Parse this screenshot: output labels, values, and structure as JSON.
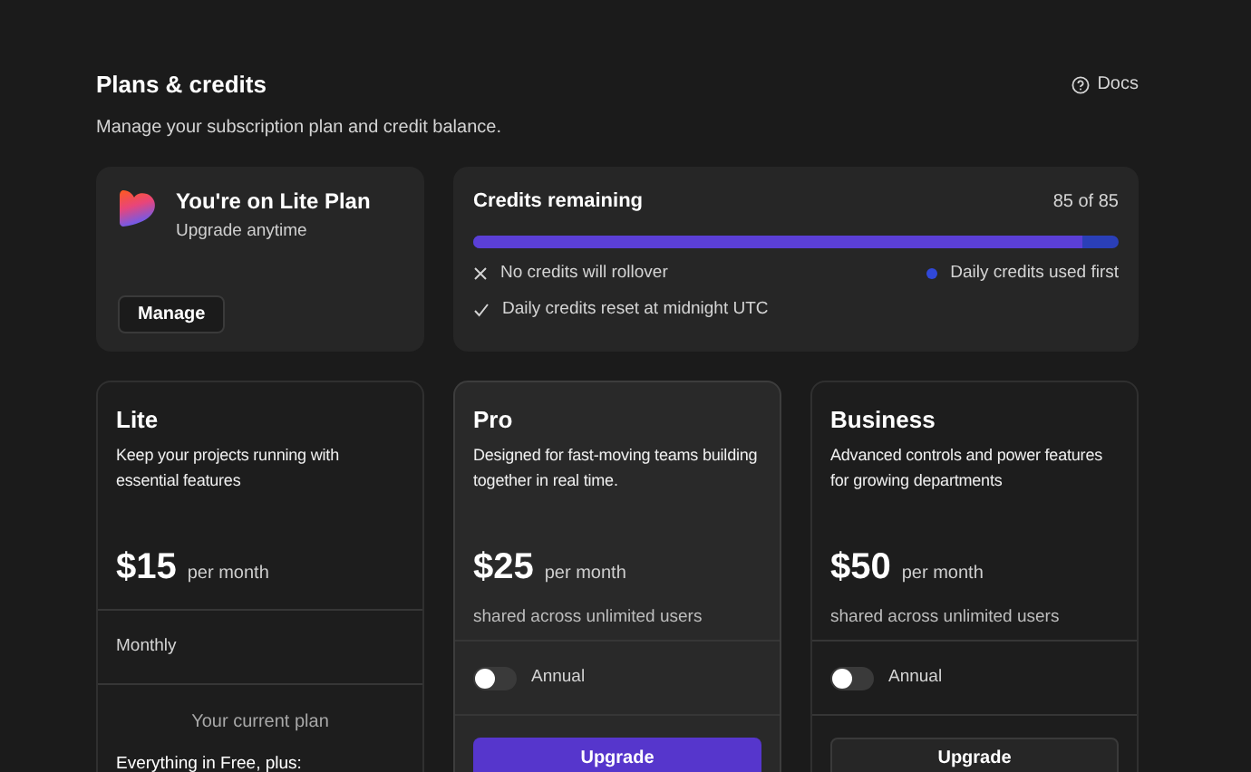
{
  "header": {
    "title": "Plans & credits",
    "subtitle": "Manage your subscription plan and credit balance.",
    "docs_link": "Docs"
  },
  "current_plan": {
    "title": "You're on Lite Plan",
    "subtitle": "Upgrade anytime",
    "button": "Manage"
  },
  "credits": {
    "title": "Credits remaining",
    "count": "85 of 85",
    "level": 0.945,
    "notes": [
      {
        "kind": "cross",
        "text": "No credits will rollover"
      },
      {
        "kind": "check",
        "text": "Daily credits reset at midnight UTC"
      }
    ],
    "legend": {
      "text": "Daily credits used first",
      "color": "#3048d8"
    }
  },
  "plans": [
    {
      "name": "Lite",
      "description": "Keep your projects running with essential features",
      "price": "$15",
      "period": "per month",
      "featured": false,
      "billing": {
        "kind": "label",
        "text": "Monthly"
      },
      "action": {
        "kind": "current",
        "text": "Your current plan"
      },
      "features_heading": "Everything in Free, plus:"
    },
    {
      "name": "Pro",
      "description": "Designed for fast-moving teams building together in real time.",
      "price": "$25",
      "period": "per month",
      "note": "shared across unlimited users",
      "featured": true,
      "billing": {
        "kind": "toggle",
        "text": "Annual",
        "on": false
      },
      "action": {
        "kind": "button",
        "text": "Upgrade"
      }
    },
    {
      "name": "Business",
      "description": "Advanced controls and power features for growing departments",
      "price": "$50",
      "period": "per month",
      "note": "shared across unlimited users",
      "featured": false,
      "billing": {
        "kind": "toggle",
        "text": "Annual",
        "on": false
      },
      "action": {
        "kind": "button",
        "text": "Upgrade"
      }
    }
  ]
}
